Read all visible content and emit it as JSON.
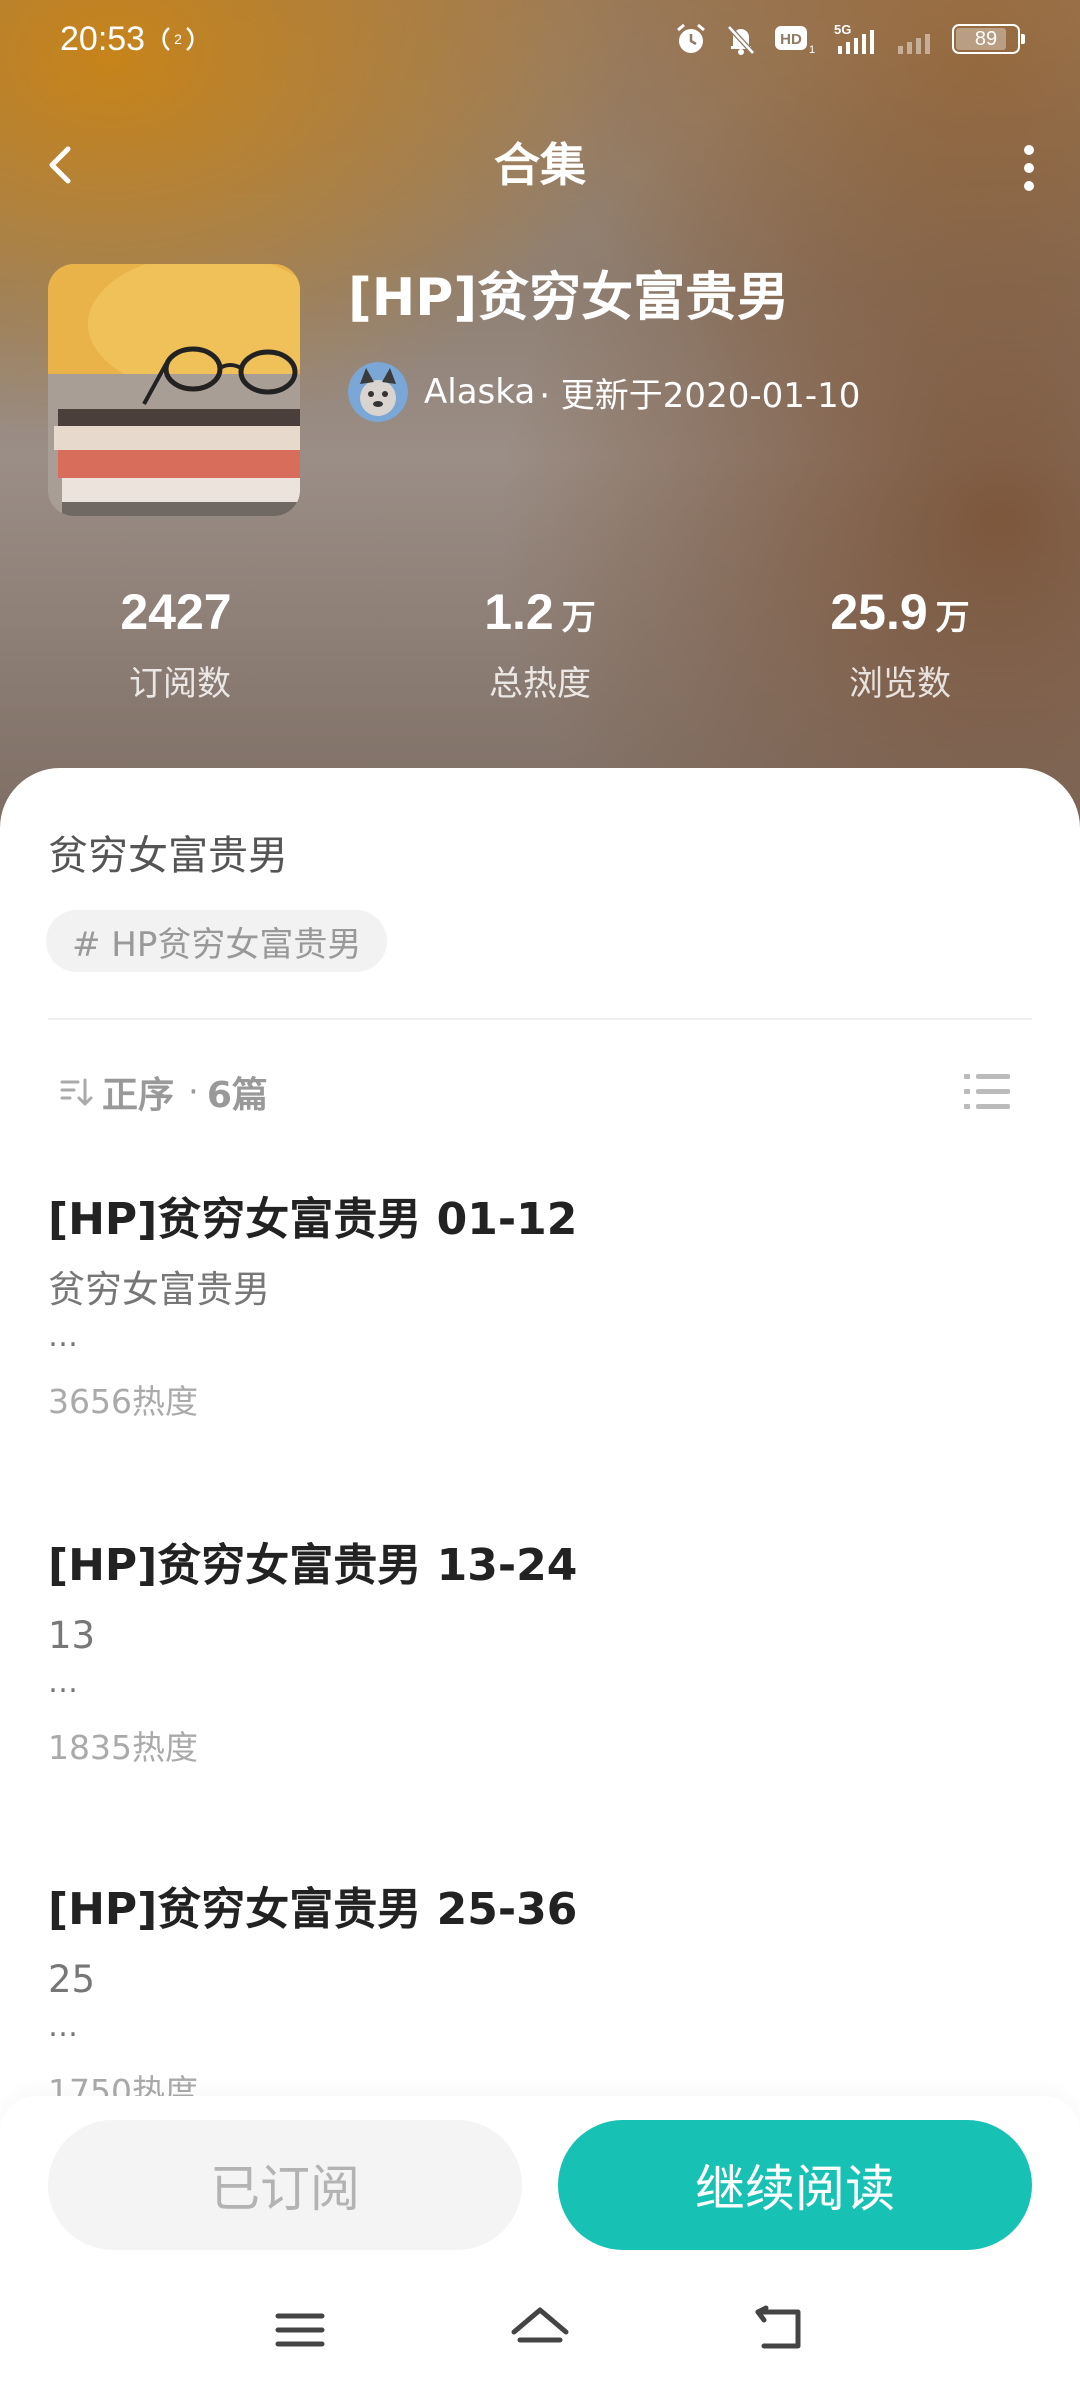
{
  "status_bar": {
    "time": "20:53",
    "battery": "89",
    "network": "5G"
  },
  "nav": {
    "title": "合集"
  },
  "collection": {
    "title": "[HP]贫穷女富贵男",
    "author": "Alaska",
    "updated": "· 更新于2020-01-10",
    "description": "贫穷女富贵男",
    "tag": "# HP贫穷女富贵男"
  },
  "stats": [
    {
      "value": "2427",
      "unit": "",
      "label": "订阅数"
    },
    {
      "value": "1.2",
      "unit": "万",
      "label": "总热度"
    },
    {
      "value": "25.9",
      "unit": "万",
      "label": "浏览数"
    }
  ],
  "sort": {
    "label": "正序",
    "dot": "·",
    "count": "6篇"
  },
  "chapters": [
    {
      "title": "[HP]贫穷女富贵男 01-12",
      "excerpt": "贫穷女富贵男",
      "ellipsis": "…",
      "heat": "3656热度"
    },
    {
      "title": "[HP]贫穷女富贵男 13-24",
      "excerpt": "13",
      "ellipsis": "…",
      "heat": "1835热度"
    },
    {
      "title": "[HP]贫穷女富贵男 25-36",
      "excerpt": "25",
      "ellipsis": "…",
      "heat": "1750热度"
    }
  ],
  "actions": {
    "subscribed": "已订阅",
    "continue": "继续阅读"
  },
  "colors": {
    "accent": "#17c1b4",
    "title_text": "#222222",
    "muted_text": "#999999"
  }
}
